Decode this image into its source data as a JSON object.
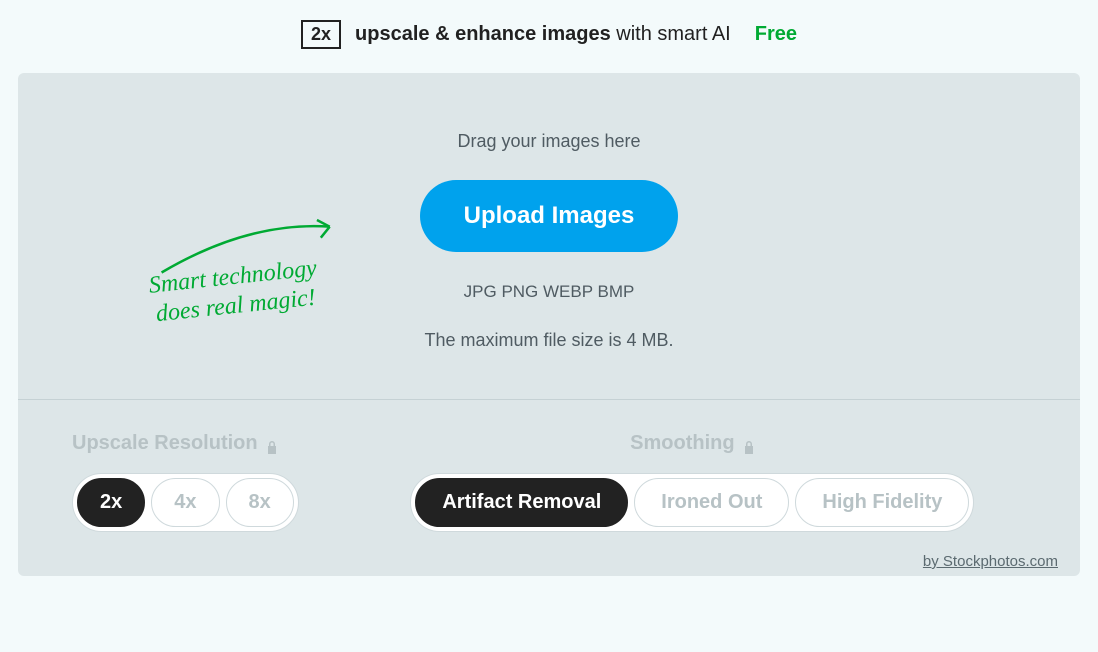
{
  "headline": {
    "badge": "2x",
    "bold": "upscale & enhance images",
    "light": " with smart AI",
    "free": "Free"
  },
  "drop": {
    "drag": "Drag your images here",
    "upload": "Upload Images",
    "formats": "JPG PNG WEBP BMP",
    "maxsize": "The maximum file size is 4 MB."
  },
  "callout": {
    "line1": "Smart technology",
    "line2": "does real magic!"
  },
  "resolution": {
    "title": "Upscale Resolution",
    "options": [
      {
        "label": "2x",
        "active": true
      },
      {
        "label": "4x",
        "active": false
      },
      {
        "label": "8x",
        "active": false
      }
    ]
  },
  "smoothing": {
    "title": "Smoothing",
    "options": [
      {
        "label": "Artifact Removal",
        "active": true
      },
      {
        "label": "Ironed Out",
        "active": false
      },
      {
        "label": "High Fidelity",
        "active": false
      }
    ]
  },
  "footer": "by Stockphotos.com"
}
